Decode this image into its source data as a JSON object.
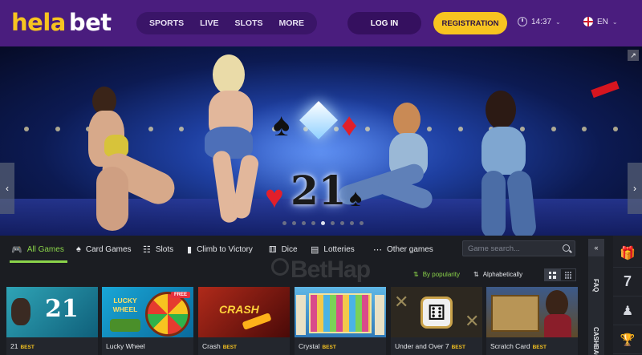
{
  "header": {
    "logo_part1": "hela",
    "logo_part2": "bet",
    "nav": [
      "SPORTS",
      "LIVE",
      "SLOTS",
      "MORE"
    ],
    "login_label": "LOG IN",
    "registration_label": "REGISTRATION",
    "time": "14:37",
    "language": "EN"
  },
  "banner": {
    "center_number": "21",
    "slide_count": 9,
    "active_slide": 4
  },
  "categories": [
    {
      "label": "All Games",
      "icon": "gamepad-icon",
      "active": true
    },
    {
      "label": "Card Games",
      "icon": "spade-icon",
      "active": false
    },
    {
      "label": "Slots",
      "icon": "slots-icon",
      "active": false
    },
    {
      "label": "Climb to Victory",
      "icon": "bar-chart-icon",
      "active": false
    },
    {
      "label": "Dice",
      "icon": "dice-icon",
      "active": false
    },
    {
      "label": "Lotteries",
      "icon": "ticket-icon",
      "active": false
    },
    {
      "label": "Other games",
      "icon": "dots-icon",
      "active": false
    }
  ],
  "search": {
    "placeholder": "Game search..."
  },
  "sort": {
    "by_popularity": "By popularity",
    "alphabetically": "Alphabetically"
  },
  "watermark": "BetHap",
  "games": [
    {
      "name": "21",
      "badge": "BEST",
      "tile_text": "21"
    },
    {
      "name": "Lucky Wheel",
      "badge": "",
      "tile_text": "LUCKY WHEEL",
      "tag": "FREE"
    },
    {
      "name": "Crash",
      "badge": "BEST",
      "tile_text": "CRASH"
    },
    {
      "name": "Crystal",
      "badge": "BEST",
      "tile_text": ""
    },
    {
      "name": "Under and Over 7",
      "badge": "BEST",
      "tile_text": ""
    },
    {
      "name": "Scratch Card",
      "badge": "BEST",
      "tile_text": ""
    }
  ],
  "side_panel": {
    "faq": "FAQ",
    "cashback": "CASHBACK"
  },
  "icon_column": {
    "seven": "7"
  },
  "colors": {
    "header_bg": "#4a1d7e",
    "accent_yellow": "#f7c420",
    "active_green": "#8bd44a",
    "page_bg": "#1b1d22"
  }
}
